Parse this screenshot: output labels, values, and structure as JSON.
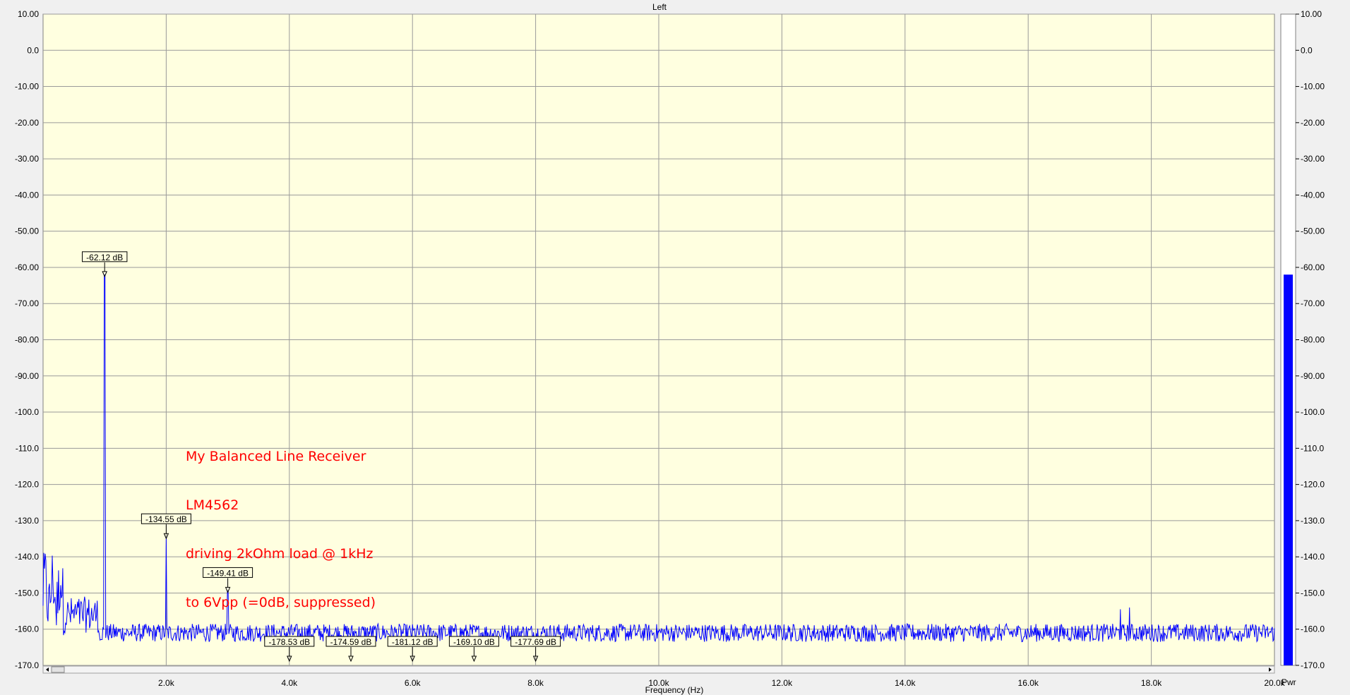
{
  "chart_data": {
    "type": "line",
    "title": "Left",
    "xlabel": "Frequency (Hz)",
    "ylabel": "",
    "xlim": [
      0,
      20000
    ],
    "ylim": [
      -170,
      10
    ],
    "grid": true,
    "y_ticks": [
      "10.00",
      "0.0",
      "-10.00",
      "-20.00",
      "-30.00",
      "-40.00",
      "-50.00",
      "-60.00",
      "-70.00",
      "-80.00",
      "-90.00",
      "-100.0",
      "-110.0",
      "-120.0",
      "-130.0",
      "-140.0",
      "-150.0",
      "-160.0",
      "-170.0"
    ],
    "x_ticks": [
      "2.0k",
      "4.0k",
      "6.0k",
      "8.0k",
      "10.0k",
      "12.0k",
      "14.0k",
      "16.0k",
      "18.0k",
      "20.0k"
    ],
    "series": [
      {
        "color": "#0000ff",
        "noise_floor_db": -161,
        "peaks": [
          {
            "freq": 1000,
            "db": -62.12
          },
          {
            "freq": 2000,
            "db": -134.55
          },
          {
            "freq": 3000,
            "db": -149.41
          },
          {
            "freq": 17500,
            "db": -154.5
          },
          {
            "freq": 17650,
            "db": -154
          }
        ]
      }
    ],
    "markers": [
      {
        "freq": 1000,
        "db": -62.12,
        "label": "-62.12 dB"
      },
      {
        "freq": 2000,
        "db": -134.55,
        "label": "-134.55 dB"
      },
      {
        "freq": 3000,
        "db": -149.41,
        "label": "-149.41 dB"
      },
      {
        "freq": 4000,
        "db": -178.53,
        "label": "-178.53 dB"
      },
      {
        "freq": 5000,
        "db": -174.59,
        "label": "-174.59 dB"
      },
      {
        "freq": 6000,
        "db": -181.12,
        "label": "-181.12 dB"
      },
      {
        "freq": 7000,
        "db": -169.1,
        "label": "-169.10 dB"
      },
      {
        "freq": 8000,
        "db": -177.69,
        "label": "-177.69 dB"
      }
    ],
    "annotation": [
      "My Balanced Line Receiver",
      "LM4562",
      "driving 2kOhm load @ 1kHz",
      "to 6Vpp (=0dB, suppressed)"
    ],
    "level_meter": {
      "label": "Pwr",
      "value_db": -62,
      "color": "#0000ff"
    }
  }
}
